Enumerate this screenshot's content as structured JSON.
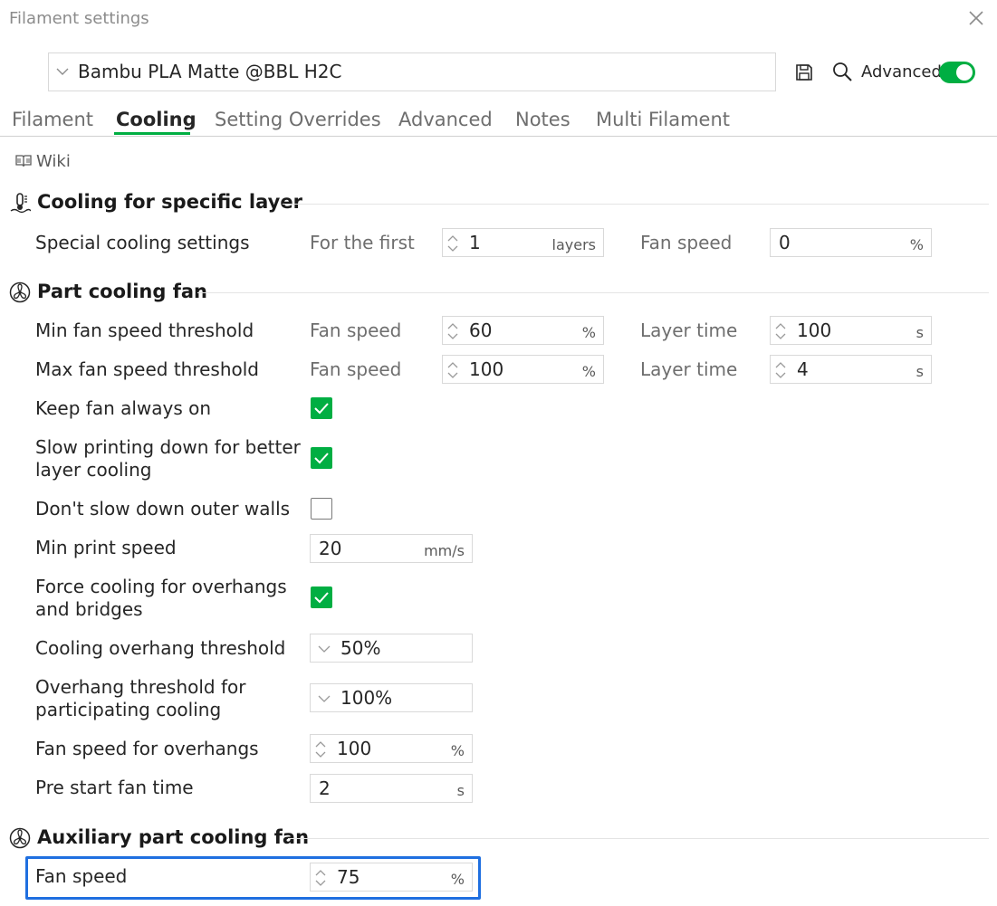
{
  "window": {
    "title": "Filament settings"
  },
  "preset": {
    "name": "Bambu PLA Matte @BBL H2C"
  },
  "header": {
    "advanced_label": "Advanced"
  },
  "tabs": [
    {
      "label": "Filament"
    },
    {
      "label": "Cooling"
    },
    {
      "label": "Setting Overrides"
    },
    {
      "label": "Advanced"
    },
    {
      "label": "Notes"
    },
    {
      "label": "Multi Filament"
    }
  ],
  "wiki": {
    "label": "Wiki"
  },
  "sections": {
    "specific_layer": {
      "title": "Cooling for specific layer",
      "special": {
        "label": "Special cooling settings",
        "for_first_label": "For the first",
        "layers_value": "1",
        "layers_unit": "layers",
        "fan_speed_label": "Fan speed",
        "fan_speed_value": "0",
        "fan_speed_unit": "%"
      }
    },
    "part_fan": {
      "title": "Part cooling fan",
      "min_threshold": {
        "label": "Min fan speed threshold",
        "fan_label": "Fan speed",
        "fan_value": "60",
        "fan_unit": "%",
        "time_label": "Layer time",
        "time_value": "100",
        "time_unit": "s"
      },
      "max_threshold": {
        "label": "Max fan speed threshold",
        "fan_label": "Fan speed",
        "fan_value": "100",
        "fan_unit": "%",
        "time_label": "Layer time",
        "time_value": "4",
        "time_unit": "s"
      },
      "keep_on": {
        "label": "Keep fan always on",
        "checked": true
      },
      "slow_down": {
        "label_line1": "Slow printing down for better",
        "label_line2": "layer cooling",
        "checked": true
      },
      "dont_slow_outer": {
        "label": "Don't slow down outer walls",
        "checked": false
      },
      "min_print_speed": {
        "label": "Min print speed",
        "value": "20",
        "unit": "mm/s"
      },
      "force_overhang": {
        "label_line1": "Force cooling for overhangs",
        "label_line2": "and bridges",
        "checked": true
      },
      "overhang_threshold": {
        "label": "Cooling overhang threshold",
        "value": "50%"
      },
      "participating": {
        "label_line1": "Overhang threshold for",
        "label_line2": "participating cooling",
        "value": "100%"
      },
      "overhang_fan": {
        "label": "Fan speed for overhangs",
        "value": "100",
        "unit": "%"
      },
      "pre_start": {
        "label": "Pre start fan time",
        "value": "2",
        "unit": "s"
      }
    },
    "aux_fan": {
      "title": "Auxiliary part cooling fan",
      "fan_speed": {
        "label": "Fan speed",
        "value": "75",
        "unit": "%"
      }
    }
  },
  "colors": {
    "accent": "#00ae42",
    "highlight": "#1f6fe0"
  }
}
